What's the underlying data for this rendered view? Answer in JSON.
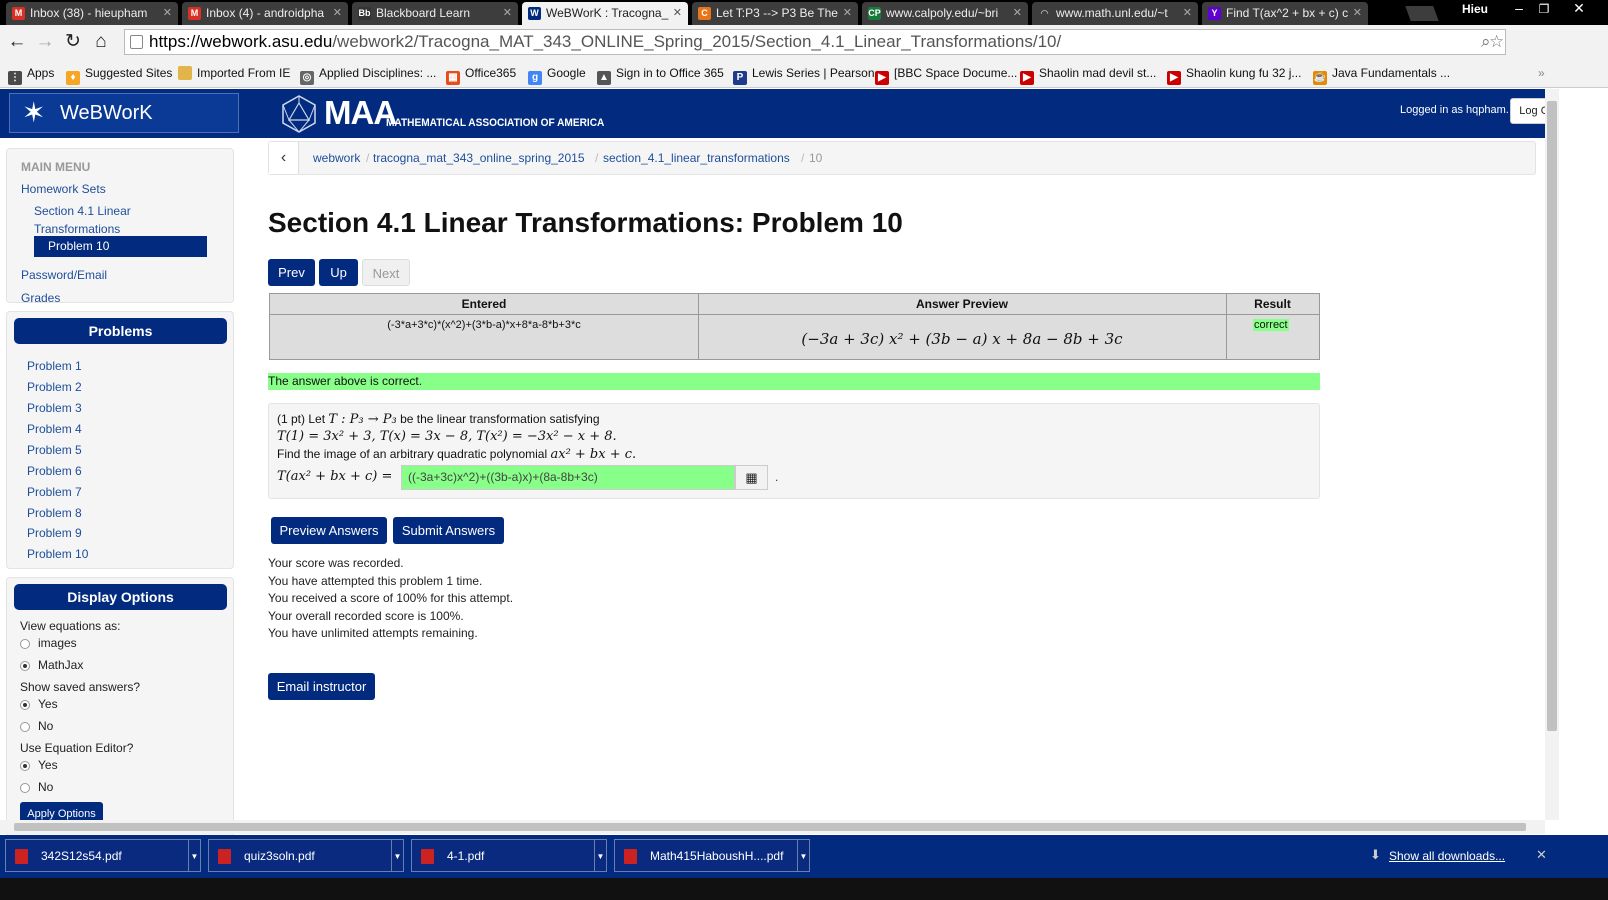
{
  "browser": {
    "tabs": [
      {
        "label": "Inbox (38) - hieupham",
        "icon": "gmail-icon",
        "color": "#d93025",
        "letter": "M"
      },
      {
        "label": "Inbox (4) - androidpha",
        "icon": "gmail-icon",
        "color": "#d93025",
        "letter": "M"
      },
      {
        "label": "Blackboard Learn",
        "icon": "blackboard-icon",
        "color": "#333333",
        "letter": "Bb"
      },
      {
        "label": "WeBWorK : Tracogna_",
        "icon": "webwork-icon",
        "color": "#022b80",
        "letter": "W"
      },
      {
        "label": "Let T:P3 --> P3 Be The",
        "icon": "chegg-icon",
        "color": "#e8751a",
        "letter": "C"
      },
      {
        "label": "www.calpoly.edu/~bri",
        "icon": "calpoly-icon",
        "color": "#1a7a3a",
        "letter": "CP"
      },
      {
        "label": "www.math.unl.edu/~t",
        "icon": "loading-icon",
        "color": "#777777",
        "letter": ""
      },
      {
        "label": "Find T(ax^2 + bx + c) c",
        "icon": "yahoo-icon",
        "color": "#5f01d1",
        "letter": "Y"
      }
    ],
    "username": "Hieu",
    "url_host": "https://webwork.asu.edu",
    "url_path": "/webwork2/Tracogna_MAT_343_ONLINE_Spring_2015/Section_4.1_Linear_Transformations/10/",
    "bookmarks": [
      {
        "label": "Apps",
        "icon": "apps-icon",
        "color": "#4a4a4a",
        "letter": "⋮"
      },
      {
        "label": "Suggested Sites",
        "icon": "suggested-sites-icon",
        "color": "#f5a623",
        "letter": "♦"
      },
      {
        "label": "Imported From IE",
        "icon": "folder-icon",
        "color": "#e2b54a",
        "letter": ""
      },
      {
        "label": "Applied Disciplines: ...",
        "icon": "site-icon",
        "color": "#666666",
        "letter": "◎"
      },
      {
        "label": "Office365",
        "icon": "office365-icon",
        "color": "#e74c1c",
        "letter": "▦"
      },
      {
        "label": "Google",
        "icon": "google-icon",
        "color": "#4285f4",
        "letter": "g"
      },
      {
        "label": "Sign in to Office 365",
        "icon": "lock-site-icon",
        "color": "#555555",
        "letter": "▲"
      },
      {
        "label": "Lewis Series | Pearson",
        "icon": "pearson-icon",
        "color": "#1e3a8a",
        "letter": "P"
      },
      {
        "label": "[BBC Space Docume...",
        "icon": "youtube-icon",
        "color": "#cc0000",
        "letter": "▶"
      },
      {
        "label": "Shaolin mad devil st...",
        "icon": "youtube-icon",
        "color": "#cc0000",
        "letter": "▶"
      },
      {
        "label": "Shaolin kung fu 32 j...",
        "icon": "youtube-icon",
        "color": "#cc0000",
        "letter": "▶"
      },
      {
        "label": "Java Fundamentals ...",
        "icon": "java-icon",
        "color": "#e68a00",
        "letter": "☕"
      }
    ]
  },
  "header": {
    "app_name": "WeBWorK",
    "maa_name": "MAA",
    "maa_subtitle": "MATHEMATICAL ASSOCIATION OF AMERICA",
    "logged_in": "Logged in as hqpham.",
    "logout_label": "Log Out"
  },
  "sidebar": {
    "main_menu_title": "MAIN MENU",
    "homework_sets": "Homework Sets",
    "section_line1": "Section 4.1 Linear",
    "section_line2": "Transformations",
    "active_problem": "Problem 10",
    "password_email": "Password/Email",
    "grades": "Grades",
    "problems_title": "Problems",
    "problems": [
      "Problem 1",
      "Problem 2",
      "Problem 3",
      "Problem 4",
      "Problem 5",
      "Problem 6",
      "Problem 7",
      "Problem 8",
      "Problem 9",
      "Problem 10"
    ],
    "display_options_title": "Display Options",
    "view_equations_label": "View equations as:",
    "opt_images": "images",
    "opt_mathjax": "MathJax",
    "show_saved_label": "Show saved answers?",
    "opt_yes": "Yes",
    "opt_no": "No",
    "use_editor_label": "Use Equation Editor?",
    "apply_label": "Apply Options"
  },
  "breadcrumb": {
    "items": [
      "webwork",
      "tracogna_mat_343_online_spring_2015",
      "section_4.1_linear_transformations",
      "10"
    ]
  },
  "main": {
    "title": "Section 4.1 Linear Transformations: Problem 10",
    "prev": "Prev",
    "up": "Up",
    "next": "Next",
    "table": {
      "col_entered": "Entered",
      "col_preview": "Answer Preview",
      "col_result": "Result",
      "entered": "(-3*a+3*c)*(x^2)+(3*b-a)*x+8*a-8*b+3*c",
      "preview": "(−3a + 3c) x² + (3b − a) x + 8a − 8b + 3c",
      "result": "correct"
    },
    "correct_message": "The answer above is correct.",
    "problem": {
      "line1_prefix": "(1 pt) Let ",
      "line1_math": "T : P₃ → P₃",
      "line1_suffix": " be the linear transformation satisfying",
      "line2_math": "T(1) = 3x² + 3, T(x) = 3x − 8, T(x²) = −3x² − x + 8.",
      "line3_prefix": "Find the image of an arbitrary quadratic polynomial ",
      "line3_math": "ax² + bx + c.",
      "answer_label": "T(ax² + bx + c) =",
      "answer_value": "((-3a+3c)x^2)+((3b-a)x)+(8a-8b+3c)",
      "equation_editor_icon": "grid-icon"
    },
    "preview_button": "Preview Answers",
    "submit_button": "Submit Answers",
    "score_lines": [
      "Your score was recorded.",
      "You have attempted this problem 1 time.",
      "You received a score of 100% for this attempt.",
      "Your overall recorded score is 100%.",
      "You have unlimited attempts remaining."
    ],
    "email_button": "Email instructor"
  },
  "downloads": {
    "items": [
      "342S12s54.pdf",
      "quiz3soln.pdf",
      "4-1.pdf",
      "Math415HaboushH....pdf"
    ],
    "show_all": "Show all downloads...",
    "icon": "pdf-icon"
  },
  "colors": {
    "brand": "#022b80",
    "correct": "#88ff88",
    "link": "#1e4e9b"
  }
}
